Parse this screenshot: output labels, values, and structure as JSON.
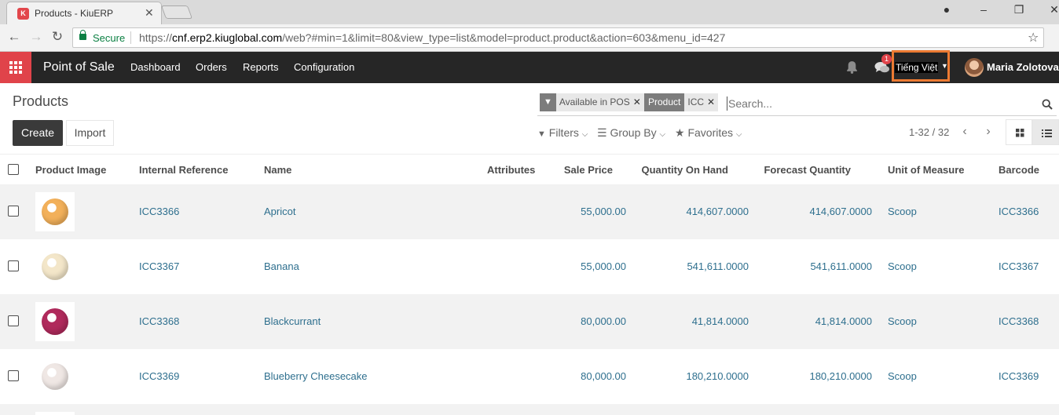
{
  "browser": {
    "tab_title": "Products - KiuERP",
    "favicon_letter": "K",
    "secure_label": "Secure",
    "url_scheme": "https://",
    "url_host": "cnf.erp2.kiuglobal.com",
    "url_path": "/web?#min=1&limit=80&view_type=list&model=product.product&action=603&menu_id=427"
  },
  "navbar": {
    "app_name": "Point of Sale",
    "menus": [
      "Dashboard",
      "Orders",
      "Reports",
      "Configuration"
    ],
    "chat_badge": "1",
    "language": "Tiếng Việt",
    "user_name": "Maria Zolotova",
    "accent_color": "#e0434a",
    "highlight_color": "#ec7a32"
  },
  "control_panel": {
    "breadcrumb": "Products",
    "create_label": "Create",
    "import_label": "Import",
    "facets": [
      {
        "icon": "filter-icon",
        "values": [
          "Available in POS"
        ]
      },
      {
        "icon": "text",
        "label": "Product",
        "values": [
          "ICC"
        ]
      }
    ],
    "search_placeholder": "Search...",
    "filters_label": "Filters",
    "groupby_label": "Group By",
    "favorites_label": "Favorites",
    "pager": "1-32 / 32"
  },
  "table": {
    "columns": [
      "Product Image",
      "Internal Reference",
      "Name",
      "Attributes",
      "Sale Price",
      "Quantity On Hand",
      "Forecast Quantity",
      "Unit of Measure",
      "Barcode"
    ],
    "rows": [
      {
        "ref": "ICC3366",
        "name": "Apricot",
        "attributes": "",
        "price": "55,000.00",
        "qty": "414,607.0000",
        "forecast": "414,607.0000",
        "uom": "Scoop",
        "barcode": "ICC3366",
        "color": "#f2b05a"
      },
      {
        "ref": "ICC3367",
        "name": "Banana",
        "attributes": "",
        "price": "55,000.00",
        "qty": "541,611.0000",
        "forecast": "541,611.0000",
        "uom": "Scoop",
        "barcode": "ICC3367",
        "color": "#f3e6c9"
      },
      {
        "ref": "ICC3368",
        "name": "Blackcurrant",
        "attributes": "",
        "price": "80,000.00",
        "qty": "41,814.0000",
        "forecast": "41,814.0000",
        "uom": "Scoop",
        "barcode": "ICC3368",
        "color": "#b02a5c"
      },
      {
        "ref": "ICC3369",
        "name": "Blueberry Cheesecake",
        "attributes": "",
        "price": "80,000.00",
        "qty": "180,210.0000",
        "forecast": "180,210.0000",
        "uom": "Scoop",
        "barcode": "ICC3369",
        "color": "#efe7e4"
      }
    ]
  }
}
